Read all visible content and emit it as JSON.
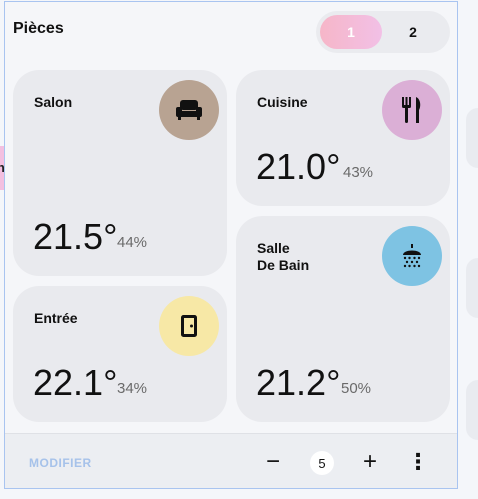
{
  "header": {
    "title": "Pièces"
  },
  "pager": {
    "page1": "1",
    "page2": "2"
  },
  "side_label": "ne",
  "rooms": [
    {
      "name": "Salon",
      "temperature": "21.5°",
      "humidity": "44%",
      "icon": "sofa-icon",
      "color": "#b8a392"
    },
    {
      "name": "Cuisine",
      "temperature": "21.0°",
      "humidity": "43%",
      "icon": "fork-knife-icon",
      "color": "#dbafd6"
    },
    {
      "name": "Entrée",
      "temperature": "22.1°",
      "humidity": "34%",
      "icon": "door-icon",
      "color": "#f7e8a6"
    },
    {
      "name": "Salle\nDe Bain",
      "temperature": "21.2°",
      "humidity": "50%",
      "icon": "shower-icon",
      "color": "#7ec3e3"
    }
  ],
  "footer": {
    "modify_label": "MODIFIER",
    "minus": "−",
    "count": "5",
    "plus": "+",
    "more": "⋮"
  },
  "accent": {
    "pager_active": "#f2c0e6",
    "modify": "#a6c2ea"
  }
}
